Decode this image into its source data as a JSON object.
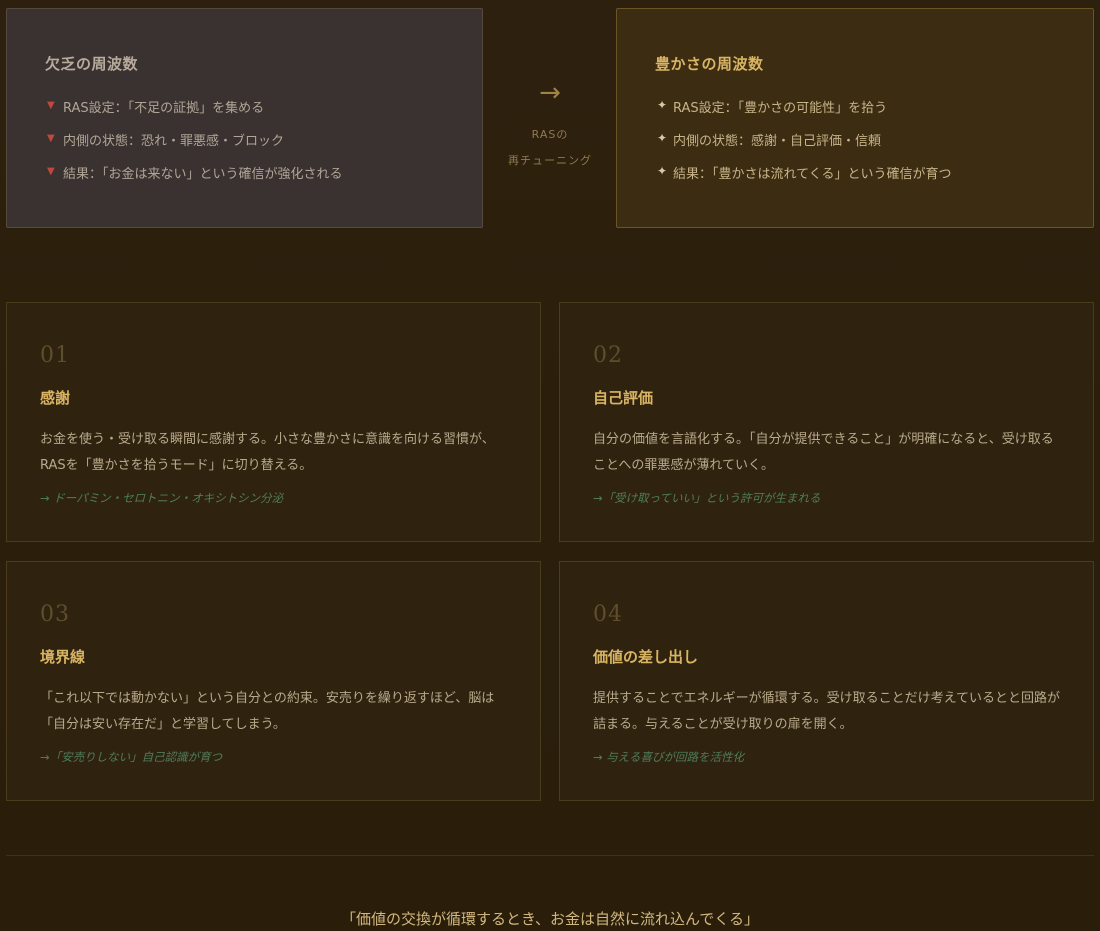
{
  "comparison": {
    "scarcity": {
      "title": "欠乏の周波数",
      "items": [
        "RAS設定：「不足の証拠」を集める",
        "内側の状態：恐れ・罪悪感・ブロック",
        "結果：「お金は来ない」という確信が強化される"
      ]
    },
    "transition": {
      "arrow": "→",
      "label_line1": "RASの",
      "label_line2": "再チューニング"
    },
    "abundance": {
      "title": "豊かさの周波数",
      "items": [
        "RAS設定：「豊かさの可能性」を拾う",
        "内側の状態：感謝・自己評価・信頼",
        "結果：「豊かさは流れてくる」という確信が育つ"
      ]
    }
  },
  "cards": [
    {
      "number": "01",
      "title": "感謝",
      "body": "お金を使う・受け取る瞬間に感謝する。小さな豊かさに意識を向ける習慣が、RASを「豊かさを拾うモード」に切り替える。",
      "note": "→ ドーパミン・セロトニン・オキシトシン分泌"
    },
    {
      "number": "02",
      "title": "自己評価",
      "body": "自分の価値を言語化する。「自分が提供できること」が明確になると、受け取ることへの罪悪感が薄れていく。",
      "note": "→「受け取っていい」という許可が生まれる"
    },
    {
      "number": "03",
      "title": "境界線",
      "body": "「これ以下では動かない」という自分との約束。安売りを繰り返すほど、脳は「自分は安い存在だ」と学習してしまう。",
      "note": "→「安売りしない」自己認識が育つ"
    },
    {
      "number": "04",
      "title": "価値の差し出し",
      "body": "提供することでエネルギーが循環する。受け取ることだけ考えているとと回路が詰まる。与えることが受け取りの扉を開く。",
      "note": "→ 与える喜びが回路を活性化"
    }
  ],
  "quote": "「価値の交換が循環するとき、お金は自然に流れ込んでくる」",
  "icons": {
    "scarcity_bullet": "▼",
    "abundance_bullet": "✦"
  },
  "colors": {
    "accent_gold": "#d9b463",
    "warning_red": "#c0483c",
    "note_green": "#4f7d59"
  }
}
